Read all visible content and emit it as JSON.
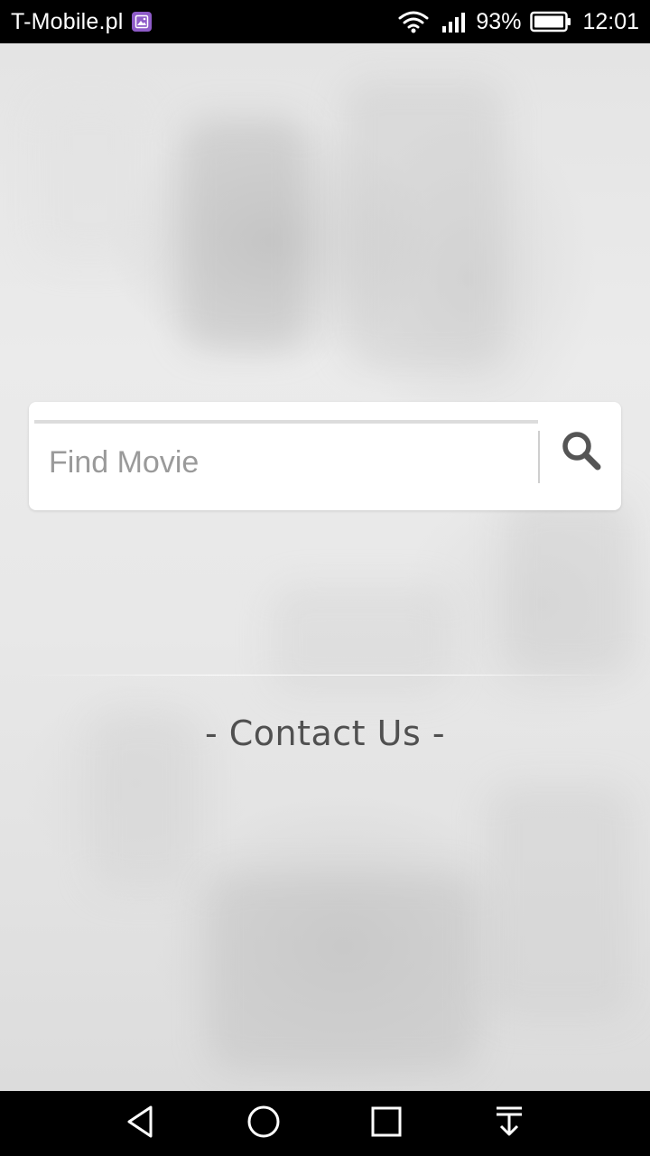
{
  "status_bar": {
    "carrier": "T-Mobile.pl",
    "battery_percent": "93%",
    "time": "12:01",
    "icons": [
      "gallery-notification-icon",
      "wifi-icon",
      "signal-icon",
      "battery-icon"
    ]
  },
  "search": {
    "placeholder": "Find Movie",
    "value": "",
    "button_icon": "search-icon"
  },
  "contact": {
    "label": "- Contact Us -"
  },
  "nav_bar": {
    "icons": [
      "back-icon",
      "home-icon",
      "recents-icon",
      "notifications-pull-icon"
    ]
  },
  "colors": {
    "status_bar": "#000000",
    "nav_bar": "#000000",
    "background": "#e6e6e6",
    "card": "#ffffff",
    "search_icon": "#555555",
    "contact_text": "#505050",
    "gallery_badge": "#8e5bc8"
  }
}
